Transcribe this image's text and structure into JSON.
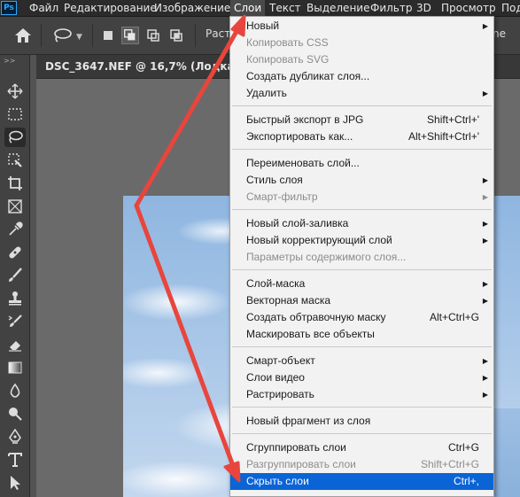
{
  "menubar": {
    "logo": "Ps",
    "items": [
      "Файл",
      "Редактирование",
      "Изображение",
      "Слои",
      "Текст",
      "Выделение",
      "Фильтр",
      "3D",
      "Просмотр",
      "Под"
    ],
    "active": "Слои"
  },
  "options_bar": {
    "rasterize_partial": "Раст",
    "right_partial": "ne"
  },
  "document_tab": {
    "title": "DSC_3647.NEF @ 16,7% (Лодка, R"
  },
  "toolbar": {
    "collapse_glyph": ">>",
    "tools": [
      "move-icon",
      "marquee-icon",
      "lasso-icon",
      "quick-select-icon",
      "crop-icon",
      "frame-icon",
      "eyedropper-icon",
      "healing-icon",
      "brush-icon",
      "stamp-icon",
      "history-brush-icon",
      "eraser-icon",
      "gradient-icon",
      "blur-icon",
      "dodge-icon",
      "pen-icon",
      "type-icon",
      "path-select-icon"
    ],
    "selected": "lasso-icon"
  },
  "layers_menu": {
    "items": [
      {
        "label": "Новый",
        "submenu": true
      },
      {
        "label": "Копировать CSS",
        "disabled": true
      },
      {
        "label": "Копировать SVG",
        "disabled": true
      },
      {
        "label": "Создать дубликат слоя..."
      },
      {
        "label": "Удалить",
        "submenu": true
      },
      {
        "label": "Быстрый экспорт в JPG",
        "shortcut": "Shift+Ctrl+'"
      },
      {
        "label": "Экспортировать как...",
        "shortcut": "Alt+Shift+Ctrl+'"
      },
      {
        "label": "Переименовать слой..."
      },
      {
        "label": "Стиль слоя",
        "submenu": true
      },
      {
        "label": "Смарт-фильтр",
        "submenu": true,
        "disabled": true
      },
      {
        "label": "Новый слой-заливка",
        "submenu": true
      },
      {
        "label": "Новый корректирующий слой",
        "submenu": true
      },
      {
        "label": "Параметры содержимого слоя...",
        "disabled": true
      },
      {
        "label": "Слой-маска",
        "submenu": true
      },
      {
        "label": "Векторная маска",
        "submenu": true
      },
      {
        "label": "Создать обтравочную маску",
        "shortcut": "Alt+Ctrl+G"
      },
      {
        "label": "Маскировать все объекты"
      },
      {
        "label": "Смарт-объект",
        "submenu": true
      },
      {
        "label": "Слои видео",
        "submenu": true
      },
      {
        "label": "Растрировать",
        "submenu": true
      },
      {
        "label": "Новый фрагмент из слоя"
      },
      {
        "label": "Сгруппировать слои",
        "shortcut": "Ctrl+G"
      },
      {
        "label": "Разгруппировать слои",
        "shortcut": "Shift+Ctrl+G",
        "disabled": true
      },
      {
        "label": "Скрыть слои",
        "shortcut": "Ctrl+,",
        "highlighted": true
      }
    ],
    "submenu_arrow": "▶"
  },
  "colors": {
    "highlight": "#0a64d6",
    "annotation_arrow": "#e8453c",
    "app_dark": "#2b2b2b",
    "panel": "#424242"
  }
}
